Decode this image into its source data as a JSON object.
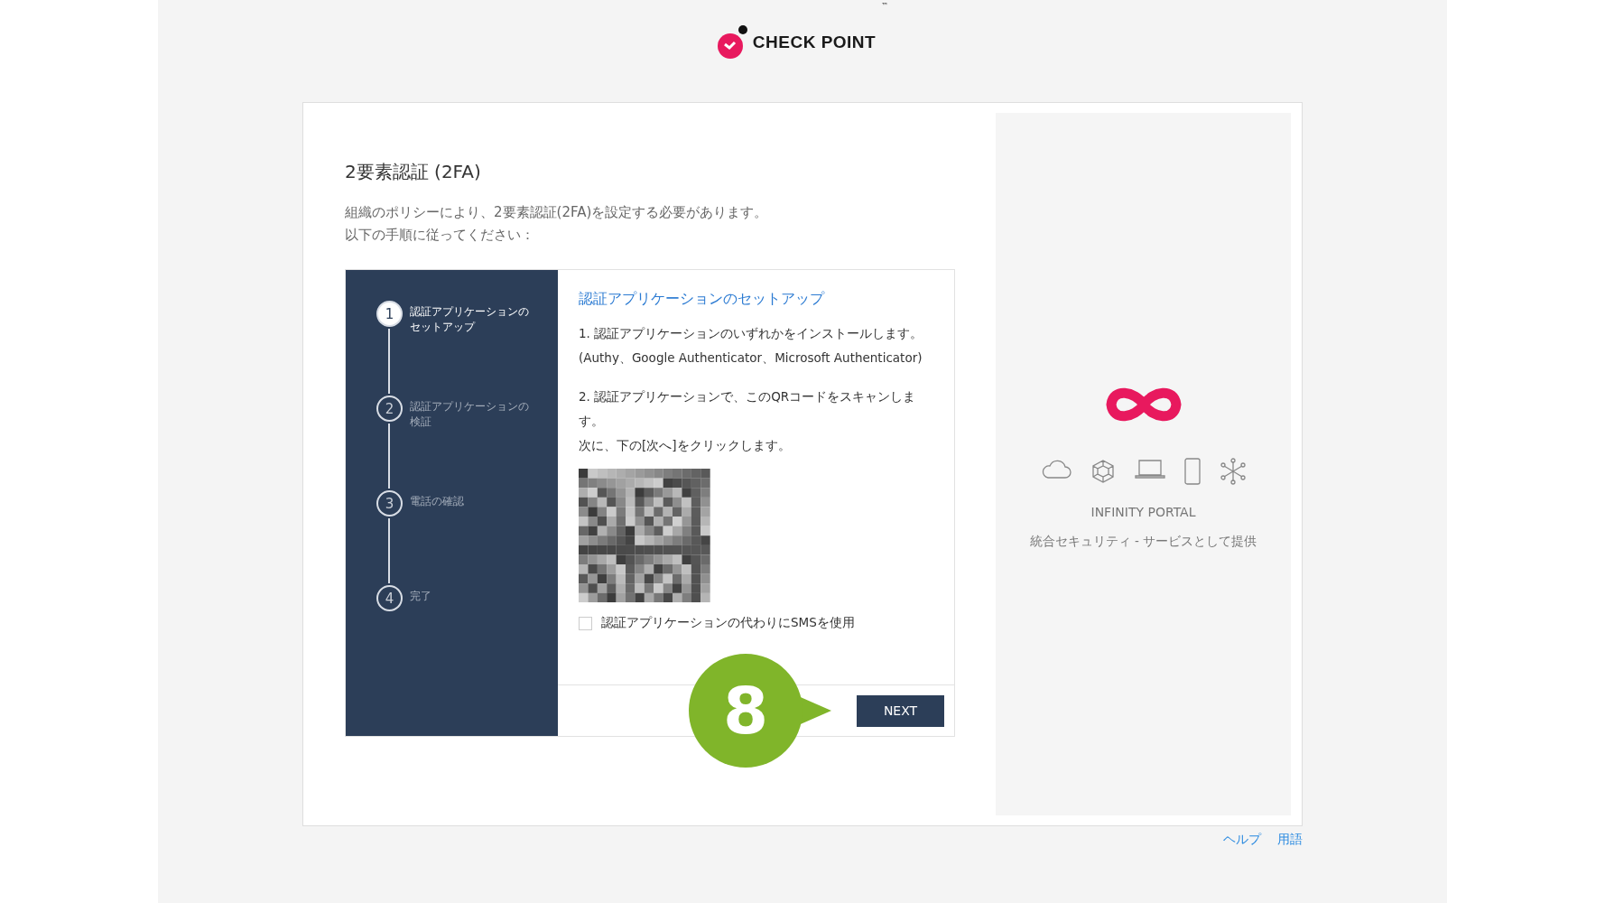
{
  "brand": {
    "name": "CHECK POINT",
    "trademark": "™"
  },
  "title": "2要素認証 (2FA)",
  "intro": [
    "組織のポリシーにより、2要素認証(2FA)を設定する必要があります。",
    "以下の手順に従ってください："
  ],
  "steps": [
    {
      "number": "1",
      "label": "認証アプリケーションのセットアップ",
      "selected": true
    },
    {
      "number": "2",
      "label": "認証アプリケーションの検証",
      "selected": false
    },
    {
      "number": "3",
      "label": "電話の確認",
      "selected": false
    },
    {
      "number": "4",
      "label": "完了",
      "selected": false
    }
  ],
  "content": {
    "heading": "認証アプリケーションのセットアップ",
    "paragraphs": [
      [
        "1. 認証アプリケーションのいずれかをインストールします。",
        "(Authy、Google Authenticator、Microsoft Authenticator)"
      ],
      [
        "2. 認証アプリケーションで、このQRコードをスキャンします。",
        "次に、下の[次へ]をクリックします。"
      ]
    ],
    "sms_option": {
      "label": "認証アプリケーションの代わりにSMSを使用",
      "checked": false
    },
    "next_button": "NEXT"
  },
  "callout": "8",
  "portal": {
    "name": "INFINITY PORTAL",
    "tagline": "統合セキュリティ - サービスとして提供"
  },
  "footer_links": [
    "ヘルプ",
    "用語"
  ]
}
